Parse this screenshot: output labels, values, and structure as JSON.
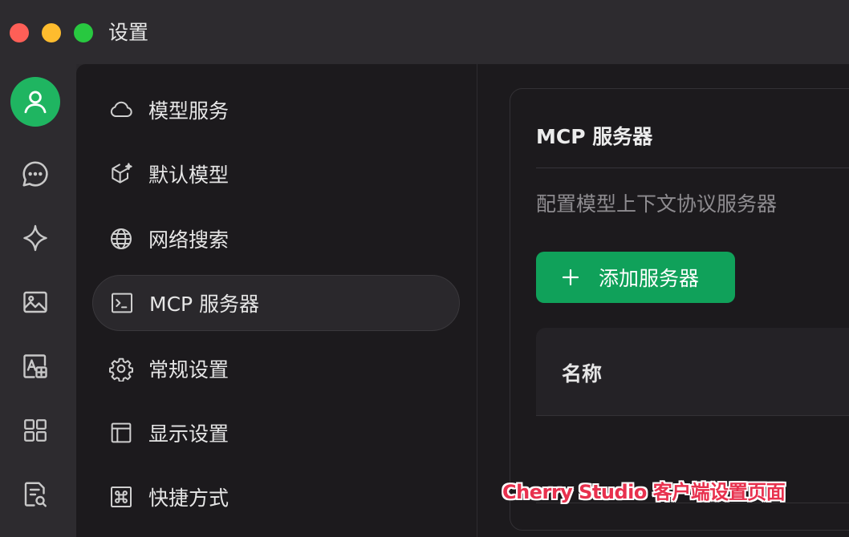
{
  "window": {
    "title": "设置"
  },
  "rail": {
    "icons": [
      "user-icon",
      "chat-icon",
      "sparkle-icon",
      "image-icon",
      "translate-icon",
      "apps-icon",
      "file-search-icon"
    ]
  },
  "menu": {
    "items": [
      {
        "label": "模型服务",
        "icon": "cloud-icon"
      },
      {
        "label": "默认模型",
        "icon": "cube-sparkle-icon"
      },
      {
        "label": "网络搜索",
        "icon": "globe-icon"
      },
      {
        "label": "MCP 服务器",
        "icon": "terminal-icon",
        "active": true
      },
      {
        "label": "常规设置",
        "icon": "gear-icon"
      },
      {
        "label": "显示设置",
        "icon": "layout-icon"
      },
      {
        "label": "快捷方式",
        "icon": "command-icon"
      }
    ]
  },
  "content": {
    "title": "MCP 服务器",
    "description": "配置模型上下文协议服务器",
    "add_button": "添加服务器",
    "table": {
      "columns": [
        "名称"
      ]
    }
  },
  "watermark": "Cherry Studio 客户端设置页面",
  "colors": {
    "accent": "#10a15a",
    "avatar": "#1fb561",
    "watermark": "#e8314e"
  }
}
